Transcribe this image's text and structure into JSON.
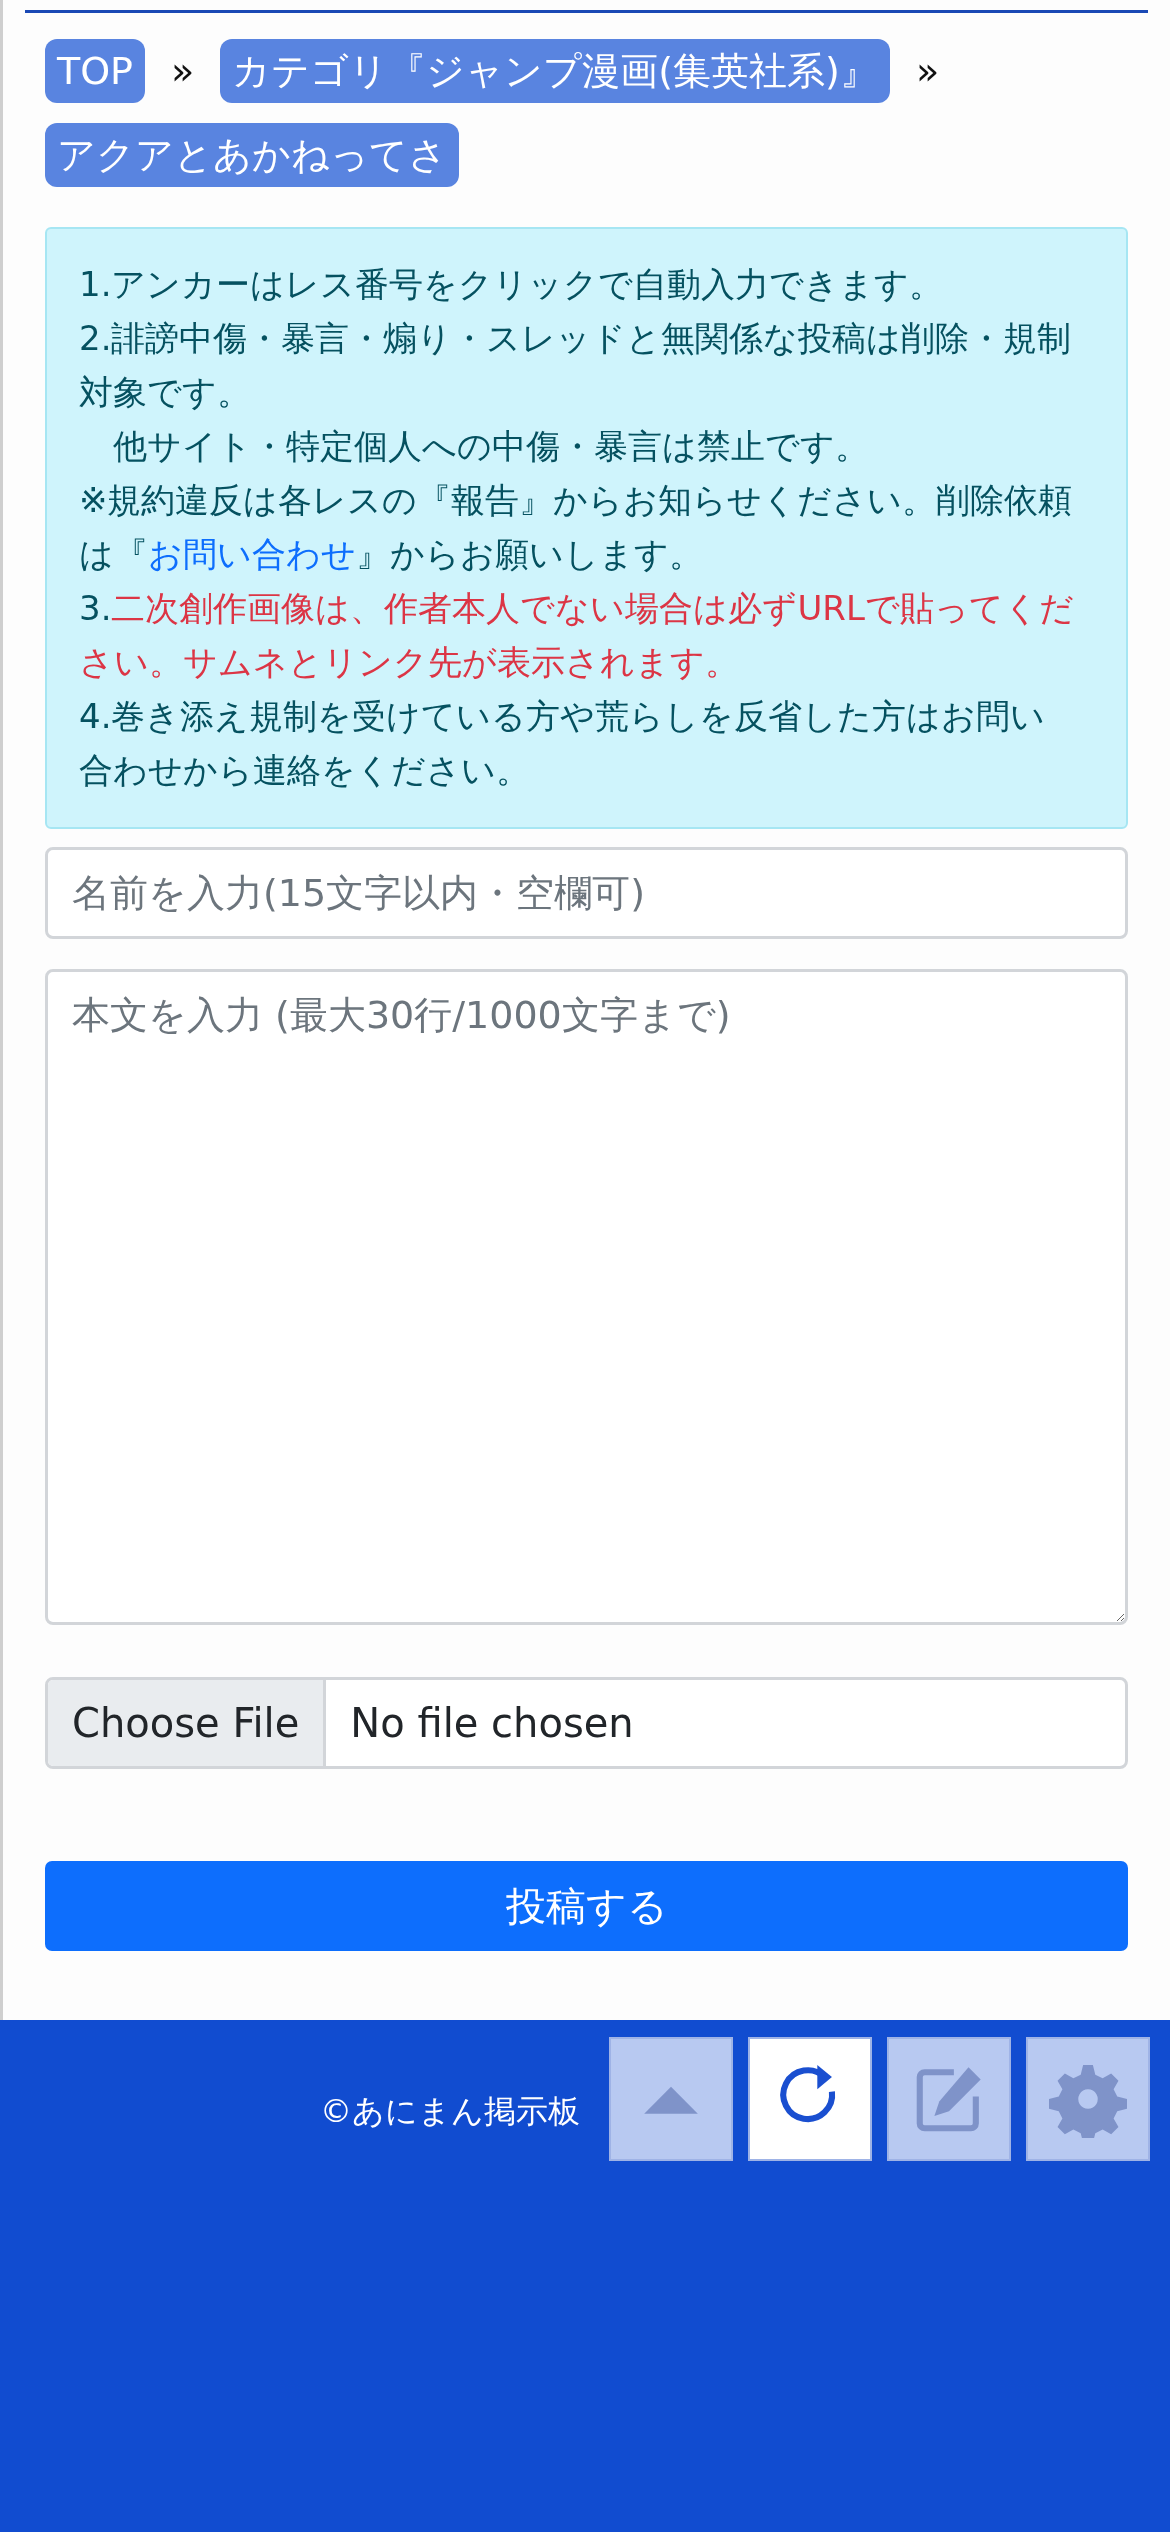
{
  "breadcrumb": [
    {
      "label": "TOP",
      "separator": "»"
    },
    {
      "label": "カテゴリ『ジャンプ漫画(集英社系)』",
      "separator": "»"
    },
    {
      "label": "アクアとあかねってさ"
    }
  ],
  "notice": [
    [
      {
        "kind": "text",
        "text": "1.アンカーはレス番号をクリックで自動入力できます。"
      }
    ],
    [
      {
        "kind": "text",
        "text": "2.誹謗中傷・暴言・煽り・スレッドと無関係な投稿は削除・規制対象です。"
      }
    ],
    [
      {
        "kind": "text",
        "text": "　他サイト・特定個人への中傷・暴言は禁止です。"
      }
    ],
    [
      {
        "kind": "text",
        "text": "※規約違反は各レスの『報告』からお知らせください。削除依頼は『"
      },
      {
        "kind": "link",
        "text": "お問い合わせ"
      },
      {
        "kind": "text",
        "text": "』からお願いします。"
      }
    ],
    [
      {
        "kind": "text",
        "text": "3."
      },
      {
        "kind": "alert",
        "text": "二次創作画像は、作者本人でない場合は必ずURLで貼ってください。サムネとリンク先が表示されます。"
      }
    ],
    [
      {
        "kind": "text",
        "text": "4.巻き添え規制を受けている方や荒らしを反省した方はお問い合わせから連絡をください。"
      }
    ]
  ],
  "name_field": {
    "placeholder": "名前を入力(15文字以内・空欄可)"
  },
  "body_field": {
    "placeholder": "本文を入力 (最大30行/1000文字まで)"
  },
  "file_input": {
    "button": "Choose File",
    "status": "No file chosen"
  },
  "submit_button": "投稿する",
  "footer": {
    "copyright": "©あにまん掲示板"
  },
  "floating_buttons": [
    {
      "kind": "up",
      "disabled": true
    },
    {
      "kind": "reload",
      "disabled": false
    },
    {
      "kind": "edit",
      "disabled": true
    },
    {
      "kind": "settings",
      "disabled": true
    }
  ]
}
